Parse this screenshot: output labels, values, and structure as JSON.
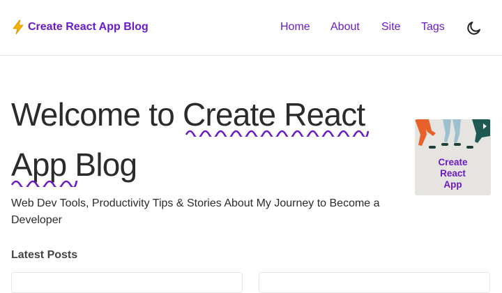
{
  "header": {
    "brand": {
      "icon": "lightning-bolt-icon",
      "label": "Create React App Blog"
    },
    "nav": [
      {
        "label": "Home"
      },
      {
        "label": "About"
      },
      {
        "label": "Site"
      },
      {
        "label": "Tags"
      }
    ],
    "theme_toggle_icon": "moon-icon"
  },
  "hero": {
    "title_plain": "Welcome to ",
    "title_highlight_1": "Create React",
    "title_highlight_2": "App",
    "title_tail": " Blog",
    "subtitle": "Web Dev Tools, Productivity Tips & Stories About My Journey to Become a Developer",
    "image_text": [
      "Create",
      "React",
      "App"
    ]
  },
  "latest_posts": {
    "title": "Latest Posts"
  },
  "colors": {
    "accent": "#6a1bc7",
    "text": "#2b2b2b",
    "border": "#e3e3e3",
    "bolt": "#f6b300"
  }
}
